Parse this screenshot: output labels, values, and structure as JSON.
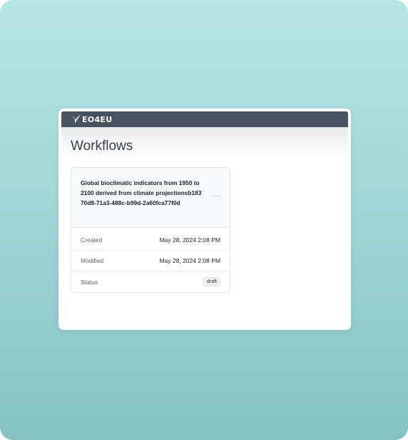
{
  "app": {
    "logo_text": "EO4EU",
    "logo_icon": "eo4eu-swoosh-icon"
  },
  "page": {
    "title": "Workflows"
  },
  "workflow_card": {
    "title": "Global bioclimatic indicators from 1950 to 2100 derived from climate projectionsb18370d8-71a3-488c-b99d-2a60fca77f0d",
    "more_icon": "ellipsis-icon",
    "more_label": "···",
    "fields": [
      {
        "label": "Created",
        "value": "May 28, 2024 2:08 PM"
      },
      {
        "label": "Modified",
        "value": "May 28, 2024 2:08 PM"
      },
      {
        "label": "Status",
        "value": "draft"
      }
    ]
  },
  "colors": {
    "topbar": "#475260",
    "background_top": "#b6e6e4",
    "background_bottom": "#85c3c3"
  }
}
